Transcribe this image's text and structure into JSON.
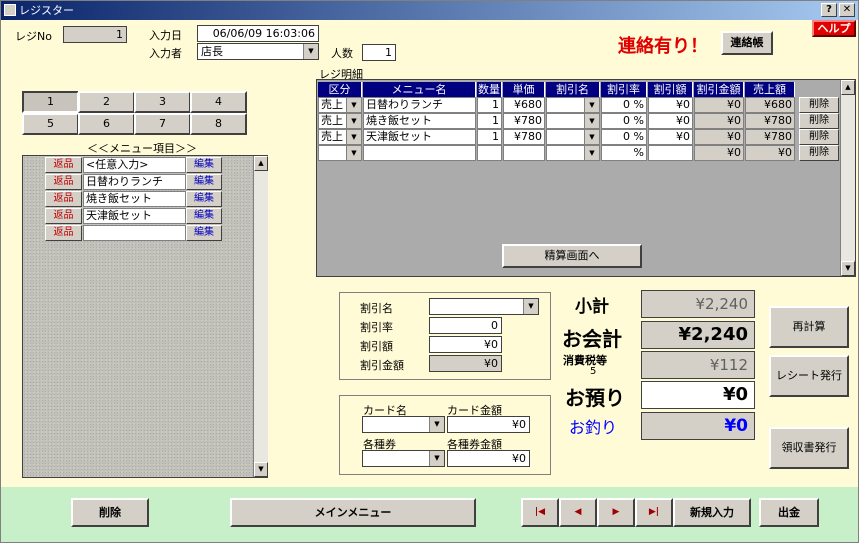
{
  "window": {
    "title": "レジスター",
    "help_btn": "?",
    "close_btn": "✕"
  },
  "header": {
    "register_no_label": "レジNo",
    "register_no": "1",
    "input_date_label": "入力日",
    "input_date": "06/06/09 16:03:06",
    "input_person_label": "入力者",
    "input_person": "店長",
    "people_label": "人数",
    "people": "1",
    "notice_text": "連絡有り！",
    "notice_btn": "連絡帳",
    "help_label": "ヘルプ"
  },
  "tabs": [
    "1",
    "2",
    "3",
    "4",
    "5",
    "6",
    "7",
    "8"
  ],
  "menu": {
    "title": "＜＜メニュー項目＞＞",
    "return_label": "返品",
    "edit_label": "編集",
    "items": [
      "<任意入力>",
      "日替わりランチ",
      "焼き飯セット",
      "天津飯セット",
      ""
    ]
  },
  "detail": {
    "title": "レジ明細",
    "headers": [
      "区分",
      "メニュー名",
      "数量",
      "単価",
      "割引名",
      "割引率",
      "割引額",
      "割引金額",
      "売上額"
    ],
    "delete_label": "削除",
    "settle_btn": "精算画面へ",
    "rows": [
      {
        "kubun": "売上",
        "name": "日替わりランチ",
        "qty": "1",
        "price": "¥680",
        "disc_name": "",
        "rate": "0 %",
        "disc": "¥0",
        "disc_amt": "¥0",
        "sales": "¥680"
      },
      {
        "kubun": "売上",
        "name": "焼き飯セット",
        "qty": "1",
        "price": "¥780",
        "disc_name": "",
        "rate": "0 %",
        "disc": "¥0",
        "disc_amt": "¥0",
        "sales": "¥780"
      },
      {
        "kubun": "売上",
        "name": "天津飯セット",
        "qty": "1",
        "price": "¥780",
        "disc_name": "",
        "rate": "0 %",
        "disc": "¥0",
        "disc_amt": "¥0",
        "sales": "¥780"
      },
      {
        "kubun": "",
        "name": "",
        "qty": "",
        "price": "",
        "disc_name": "",
        "rate": "%",
        "disc": "",
        "disc_amt": "¥0",
        "sales": "¥0"
      }
    ]
  },
  "discount": {
    "name_label": "割引名",
    "name": "",
    "rate_label": "割引率",
    "rate": "0",
    "amount_label": "割引額",
    "amount": "¥0",
    "total_label": "割引金額",
    "total": "¥0"
  },
  "payment": {
    "card_name_label": "カード名",
    "card_amount_label": "カード金額",
    "card_amount": "¥0",
    "voucher_label": "各種券",
    "voucher_amount_label": "各種券金額",
    "voucher_amount": "¥0"
  },
  "summary": {
    "subtotal_label": "小計",
    "subtotal": "¥2,240",
    "total_label": "お会計",
    "total": "¥2,240",
    "tax_label": "消費税等",
    "tax_rate": "5",
    "tax": "¥112",
    "deposit_label": "お預り",
    "deposit": "¥0",
    "change_label": "お釣り",
    "change": "¥0"
  },
  "side_buttons": {
    "recalc": "再計算",
    "receipt": "レシート発行",
    "invoice": "領収書発行"
  },
  "footer": {
    "delete": "削除",
    "main_menu": "メインメニュー",
    "first": "|◀",
    "prev": "◀",
    "next": "▶",
    "last": "▶|",
    "new_entry": "新規入力",
    "out": "出金"
  },
  "colors": {
    "notice": "#e00000",
    "header_bg": "#000080",
    "change": "#0000ff"
  }
}
